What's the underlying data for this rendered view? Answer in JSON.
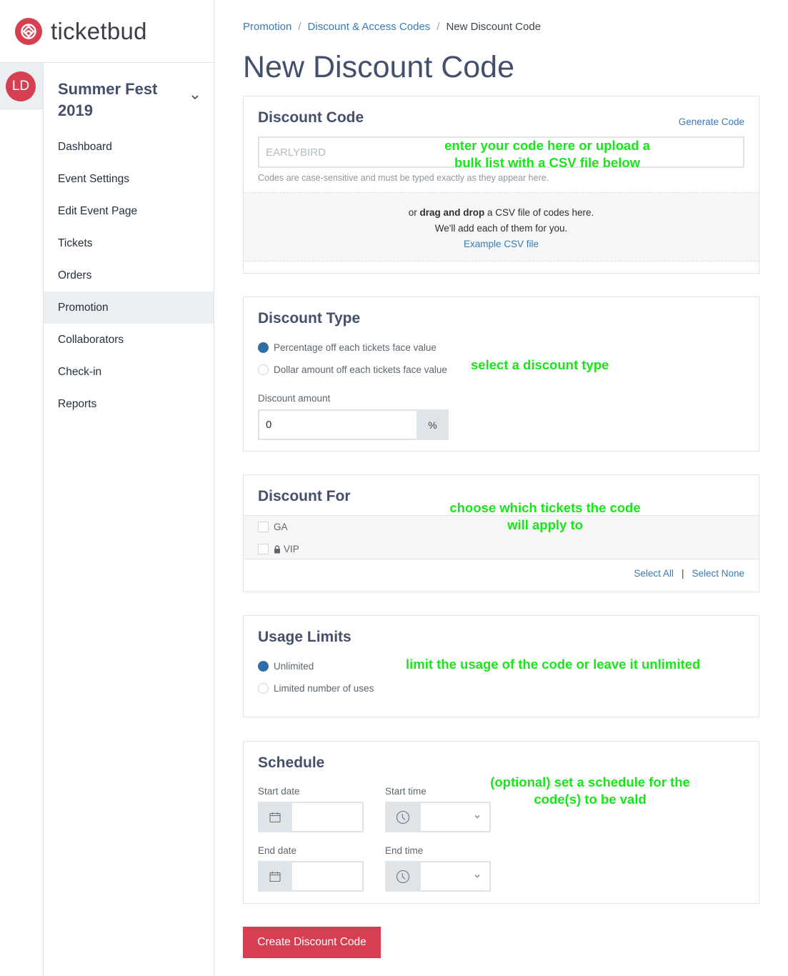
{
  "brand": {
    "name": "ticketbud",
    "accent_color": "#d53f51",
    "link_color": "#3a7ab5"
  },
  "user": {
    "initials": "LD"
  },
  "sidebar": {
    "event_name": "Summer Fest 2019",
    "items": [
      {
        "label": "Dashboard",
        "active": false
      },
      {
        "label": "Event Settings",
        "active": false
      },
      {
        "label": "Edit Event Page",
        "active": false
      },
      {
        "label": "Tickets",
        "active": false
      },
      {
        "label": "Orders",
        "active": false
      },
      {
        "label": "Promotion",
        "active": true
      },
      {
        "label": "Collaborators",
        "active": false
      },
      {
        "label": "Check-in",
        "active": false
      },
      {
        "label": "Reports",
        "active": false
      }
    ]
  },
  "breadcrumb": {
    "items": [
      "Promotion",
      "Discount & Access Codes"
    ],
    "separator": "/",
    "current": "New Discount Code"
  },
  "page_title": "New Discount Code",
  "discount_code": {
    "title": "Discount Code",
    "generate_label": "Generate Code",
    "input_value": "",
    "input_placeholder": "EARLYBIRD",
    "help_text": "Codes are case-sensitive and must be typed exactly as they appear here.",
    "dropzone": {
      "prefix": "or ",
      "bold": "drag and drop",
      "suffix": " a CSV file of codes here.",
      "line2": "We'll add each of them for you.",
      "example_link": "Example CSV file"
    },
    "annotation_line1": "enter your code here or upload a",
    "annotation_line2": "bulk list with a CSV file below"
  },
  "discount_type": {
    "title": "Discount Type",
    "options": [
      {
        "label": "Percentage off each tickets face value",
        "selected": true
      },
      {
        "label": "Dollar amount off each tickets face value",
        "selected": false
      }
    ],
    "amount_label": "Discount amount",
    "amount_value": "0",
    "amount_suffix": "%",
    "annotation": "select a discount type"
  },
  "discount_for": {
    "title": "Discount For",
    "tickets": [
      {
        "label": "GA",
        "checked": false,
        "locked": false
      },
      {
        "label": "VIP",
        "checked": false,
        "locked": true
      }
    ],
    "select_all": "Select All",
    "pipe": "|",
    "select_none": "Select None",
    "annotation_line1": "choose which tickets the code",
    "annotation_line2": "will apply to"
  },
  "usage_limits": {
    "title": "Usage Limits",
    "options": [
      {
        "label": "Unlimited",
        "selected": true
      },
      {
        "label": "Limited number of uses",
        "selected": false
      }
    ],
    "annotation": "limit the usage of the code or leave it unlimited"
  },
  "schedule": {
    "title": "Schedule",
    "start_date_label": "Start date",
    "start_time_label": "Start time",
    "end_date_label": "End date",
    "end_time_label": "End time",
    "start_date_value": "",
    "start_time_value": "",
    "end_date_value": "",
    "end_time_value": "",
    "annotation_line1": "(optional) set a schedule for the",
    "annotation_line2": "code(s) to be vald"
  },
  "submit_label": "Create Discount Code"
}
